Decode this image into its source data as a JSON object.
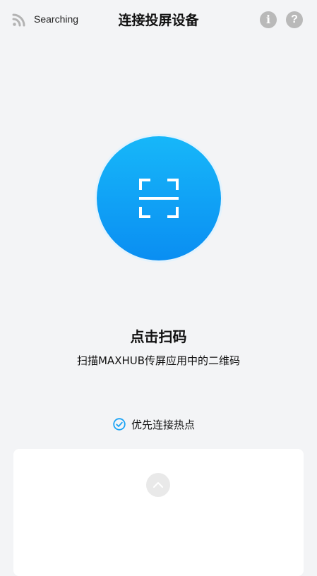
{
  "header": {
    "status_text": "Searching",
    "title": "连接投屏设备",
    "info_glyph": "i",
    "help_glyph": "?"
  },
  "scan": {
    "title": "点击扫码",
    "subtitle": "扫描MAXHUB传屏应用中的二维码"
  },
  "hotspot": {
    "label": "优先连接热点",
    "checked": true
  },
  "colors": {
    "accent": "#1aa3f5",
    "background": "#f3f4f6",
    "icon_gray": "#b9b9b9"
  },
  "icons": [
    "signal-icon",
    "info-icon",
    "help-icon",
    "scan-qr-icon",
    "check-circle-icon",
    "chevron-up-icon"
  ]
}
